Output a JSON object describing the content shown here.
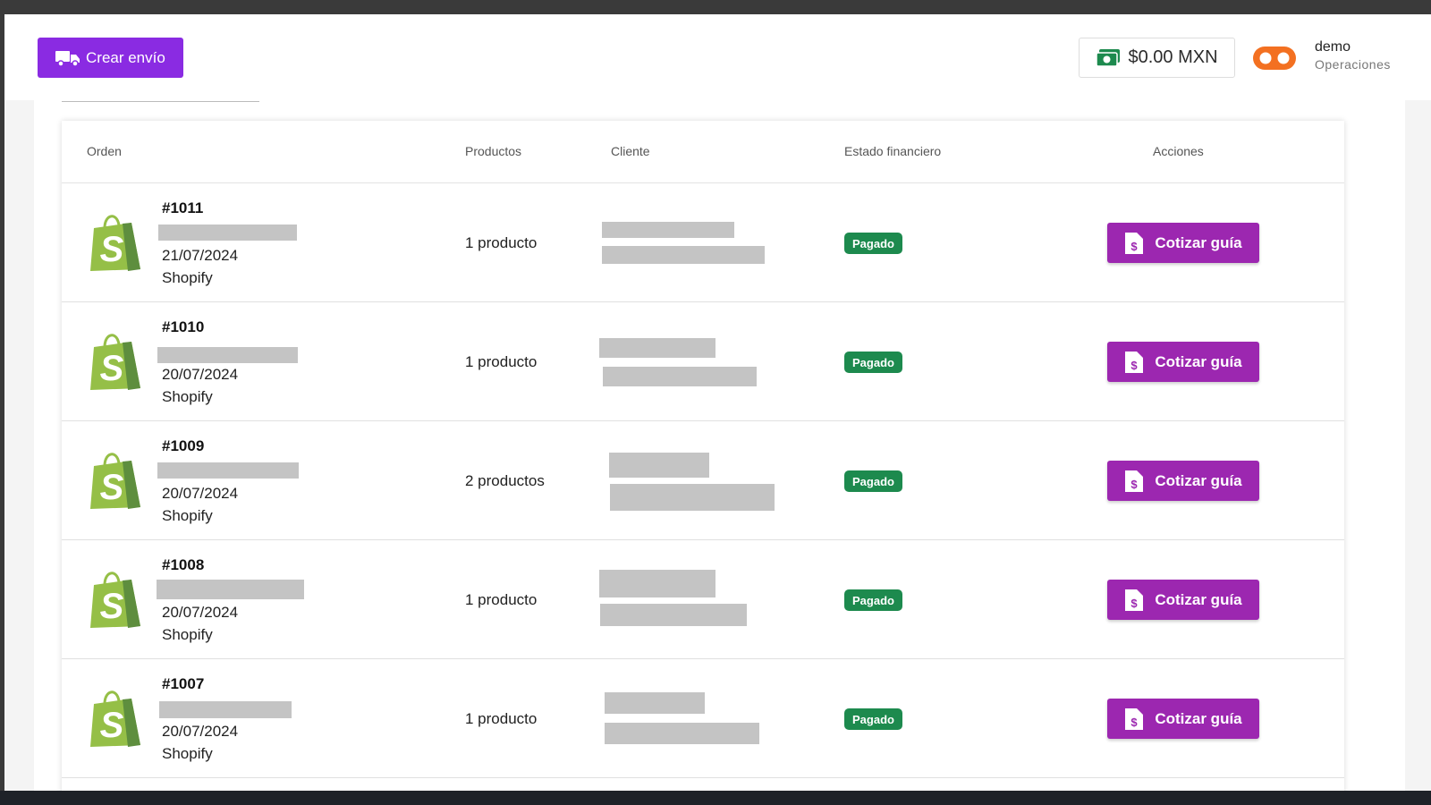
{
  "header": {
    "create_label": "Crear envío",
    "balance": "$0.00 MXN",
    "user_name": "demo",
    "user_role": "Operaciones"
  },
  "table": {
    "columns": [
      "Orden",
      "Productos",
      "Cliente",
      "Estado financiero",
      "Acciones"
    ],
    "rows": [
      {
        "order": "#1011",
        "date": "21/07/2024",
        "source": "Shopify",
        "products": "1 producto",
        "status": "Pagado",
        "action": "Cotizar guía"
      },
      {
        "order": "#1010",
        "date": "20/07/2024",
        "source": "Shopify",
        "products": "1 producto",
        "status": "Pagado",
        "action": "Cotizar guía"
      },
      {
        "order": "#1009",
        "date": "20/07/2024",
        "source": "Shopify",
        "products": "2 productos",
        "status": "Pagado",
        "action": "Cotizar guía"
      },
      {
        "order": "#1008",
        "date": "20/07/2024",
        "source": "Shopify",
        "products": "1 producto",
        "status": "Pagado",
        "action": "Cotizar guía"
      },
      {
        "order": "#1007",
        "date": "20/07/2024",
        "source": "Shopify",
        "products": "1 producto",
        "status": "Pagado",
        "action": "Cotizar guía"
      }
    ]
  },
  "colors": {
    "primary": "#8a2be2",
    "action": "#9c27b0",
    "status_paid": "#1d8a4e",
    "shopify_green": "#95bf47"
  },
  "icons": {
    "create": "truck-icon",
    "balance": "money-icon",
    "user": "user-logo-icon",
    "source": "shopify-bag-icon",
    "action": "invoice-dollar-icon"
  }
}
